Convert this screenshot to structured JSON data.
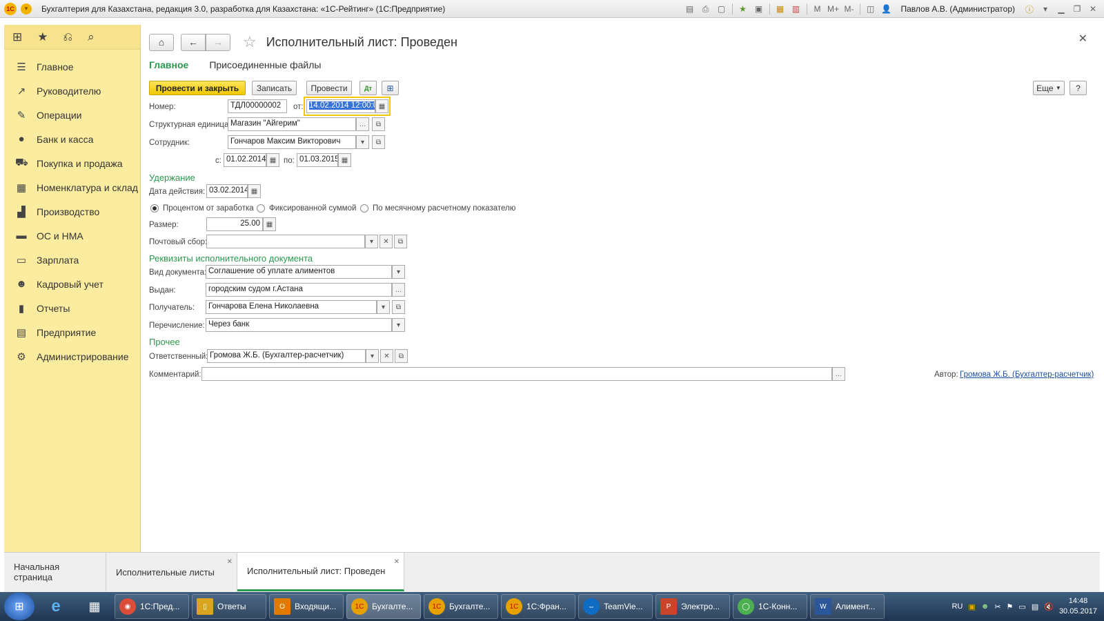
{
  "window": {
    "title": "Бухгалтерия для Казахстана, редакция 3.0, разработка для Казахстана: «1С-Рейтинг»  (1С:Предприятие)",
    "user": "Павлов А.В. (Администратор)",
    "logo": "1С"
  },
  "sidebar": {
    "top_icons": [
      "apps-grid-icon",
      "star-icon",
      "history-icon",
      "search-icon"
    ],
    "items": [
      {
        "label": "Главное",
        "icon": "menu-icon"
      },
      {
        "label": "Руководителю",
        "icon": "chart-line-icon"
      },
      {
        "label": "Операции",
        "icon": "operations-icon"
      },
      {
        "label": "Банк и касса",
        "icon": "bank-icon"
      },
      {
        "label": "Покупка и продажа",
        "icon": "cart-icon"
      },
      {
        "label": "Номенклатура и склад",
        "icon": "warehouse-icon"
      },
      {
        "label": "Производство",
        "icon": "factory-icon"
      },
      {
        "label": "ОС и НМА",
        "icon": "truck-icon"
      },
      {
        "label": "Зарплата",
        "icon": "salary-icon"
      },
      {
        "label": "Кадровый учет",
        "icon": "people-icon"
      },
      {
        "label": "Отчеты",
        "icon": "reports-icon"
      },
      {
        "label": "Предприятие",
        "icon": "enterprise-icon"
      },
      {
        "label": "Администрирование",
        "icon": "gear-icon"
      }
    ]
  },
  "document": {
    "title": "Исполнительный лист: Проведен",
    "tabs": {
      "main": "Главное",
      "files": "Присоединенные файлы"
    },
    "toolbar": {
      "post_close": "Провести и закрыть",
      "save": "Записать",
      "post": "Провести",
      "more": "Еще",
      "help": "?"
    },
    "fields": {
      "number_label": "Номер:",
      "number": "ТДЛ00000002",
      "from_label": "от:",
      "date": "14.02.2014 12:00:0",
      "unit_label": "Структурная единица:",
      "unit": "Магазин \"Айгерим\"",
      "employee_label": "Сотрудник:",
      "employee": "Гончаров Максим Викторович",
      "period_from_label": "с:",
      "period_from": "01.02.2014",
      "period_to_label": "по:",
      "period_to": "01.03.2015"
    },
    "withholding": {
      "section": "Удержание",
      "date_label": "Дата действия:",
      "date": "03.02.2014",
      "radio_percent": "Процентом от заработка",
      "radio_fixed": "Фиксированной суммой",
      "radio_mrp": "По месячному расчетному показателю",
      "size_label": "Размер:",
      "size": "25.00",
      "postal_label": "Почтовый сбор:",
      "postal": ""
    },
    "requisites": {
      "section": "Реквизиты исполнительного документа",
      "doc_type_label": "Вид документа:",
      "doc_type": "Соглашение об уплате алиментов",
      "issued_label": "Выдан:",
      "issued": "городским судом г.Астана",
      "recipient_label": "Получатель:",
      "recipient": "Гончарова Елена Николаевна",
      "transfer_label": "Перечисление:",
      "transfer": "Через банк"
    },
    "other": {
      "section": "Прочее",
      "responsible_label": "Ответственный:",
      "responsible": "Громова Ж.Б. (Бухгалтер-расчетчик)",
      "comment_label": "Комментарий:",
      "comment": "",
      "author_label": "Автор:",
      "author": "Громова Ж.Б. (Бухгалтер-расчетчик)"
    }
  },
  "bottom_tabs": [
    {
      "label": "Начальная страница",
      "closable": false,
      "active": false
    },
    {
      "label": "Исполнительные листы",
      "closable": true,
      "active": false
    },
    {
      "label": "Исполнительный лист: Проведен",
      "closable": true,
      "active": true
    }
  ],
  "taskbar": {
    "tasks": [
      {
        "label": "1С:Пред...",
        "color": "#dd4b39",
        "icon": "chrome-icon"
      },
      {
        "label": "Ответы",
        "color": "#d9a520",
        "icon": "folder-icon"
      },
      {
        "label": "Входящи...",
        "color": "#e07b00",
        "icon": "outlook-icon"
      },
      {
        "label": "Бухгалте...",
        "color": "#e5a100",
        "icon": "1c-icon",
        "active": true
      },
      {
        "label": "Бухгалте...",
        "color": "#e5a100",
        "icon": "1c-icon"
      },
      {
        "label": "1С:Фран...",
        "color": "#e5a100",
        "icon": "1c-icon"
      },
      {
        "label": "TeamVie...",
        "color": "#0e6cc4",
        "icon": "teamviewer-icon"
      },
      {
        "label": "Электро...",
        "color": "#c8442a",
        "icon": "powerpoint-icon"
      },
      {
        "label": "1С-Конн...",
        "color": "#4caf50",
        "icon": "connect-icon"
      },
      {
        "label": "Алимент...",
        "color": "#2b579a",
        "icon": "word-icon"
      }
    ],
    "lang": "RU",
    "time": "14:48",
    "date": "30.05.2017"
  }
}
